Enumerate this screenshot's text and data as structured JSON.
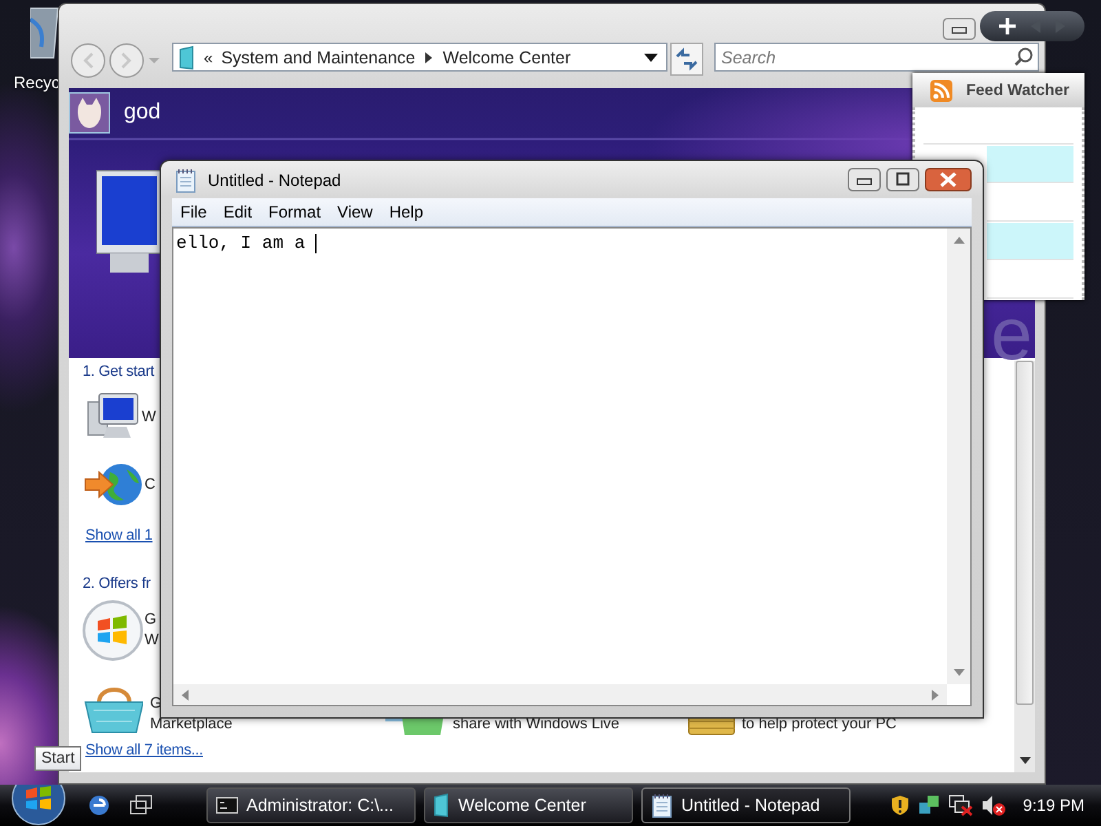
{
  "desktop": {
    "icons": [
      {
        "label": "Recyc"
      }
    ]
  },
  "welcome_center": {
    "address": {
      "prefix": "«",
      "crumbs": [
        "System and Maintenance",
        "Welcome Center"
      ]
    },
    "search": {
      "placeholder": "Search"
    },
    "user": "god",
    "header_fragment": "e",
    "sections": [
      {
        "title": "1. Get start",
        "rows": [
          [
            {
              "lines": [
                "W"
              ]
            }
          ],
          [
            {
              "lines": [
                "C"
              ]
            }
          ]
        ],
        "link": "Show all 1"
      },
      {
        "title": "2. Offers fr",
        "rows": [
          [
            {
              "lines": [
                "G",
                "W"
              ]
            }
          ],
          [
            {
              "lines": [
                "G",
                "Marketplace"
              ]
            },
            {
              "lines": [
                "share with Windows Live"
              ]
            },
            {
              "lines": [
                "to help protect your PC"
              ]
            }
          ]
        ],
        "link": "Show all 7 items..."
      }
    ]
  },
  "gadget": {
    "title": "Feed Watcher",
    "rows": [
      {
        "highlighted": false
      },
      {
        "highlighted": true
      },
      {
        "highlighted": false
      },
      {
        "highlighted": true
      },
      {
        "highlighted": false
      }
    ]
  },
  "notepad": {
    "title": "Untitled - Notepad",
    "menu": [
      "File",
      "Edit",
      "Format",
      "View",
      "Help"
    ],
    "text": "ello, I am a "
  },
  "tooltip": "Start",
  "taskbar": {
    "tasks": [
      {
        "label": "Administrator: C:\\...",
        "selected": false
      },
      {
        "label": "Welcome Center",
        "selected": false
      },
      {
        "label": "Untitled - Notepad",
        "selected": true
      }
    ],
    "clock": "9:19 PM"
  }
}
